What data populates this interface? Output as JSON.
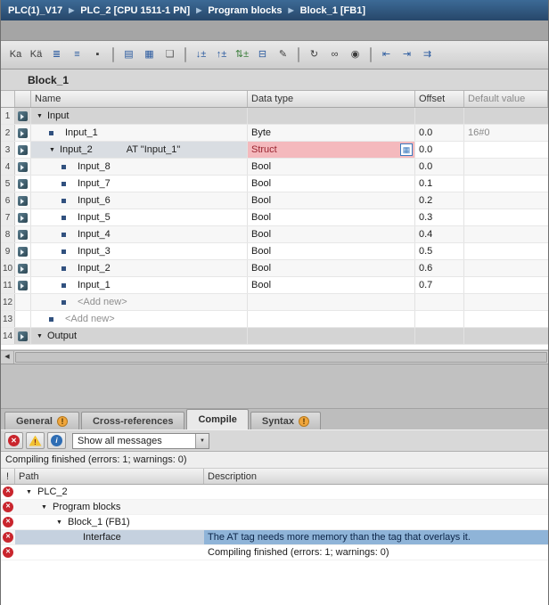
{
  "breadcrumb": {
    "items": [
      "PLC(1)_V17",
      "PLC_2 [CPU 1511-1 PN]",
      "Program blocks",
      "Block_1 [FB1]"
    ]
  },
  "block": {
    "title": "Block_1"
  },
  "toolbar": {
    "icons": [
      {
        "name": "keep-actual-values-icon",
        "glyph": "Ka",
        "color": "#3c3c3c"
      },
      {
        "name": "snapshot-actual-values-icon",
        "glyph": "Kä",
        "color": "#3c3c3c"
      },
      {
        "name": "insert-row-icon",
        "glyph": "≣",
        "color": "#2a5a9f"
      },
      {
        "name": "add-row-icon",
        "glyph": "≡",
        "color": "#2a5a9f"
      },
      {
        "name": "reset-start-values-icon",
        "glyph": "▪",
        "color": "#3c3c3c"
      },
      {
        "sep": true
      },
      {
        "name": "expand-view-icon",
        "glyph": "▤",
        "color": "#2a5a9f"
      },
      {
        "name": "tabular-view-icon",
        "glyph": "▦",
        "color": "#2a5a9f"
      },
      {
        "name": "comment-toggle-icon",
        "glyph": "❏",
        "color": "#5a5a5a"
      },
      {
        "sep": true
      },
      {
        "name": "download-values-icon",
        "glyph": "↓±",
        "color": "#2a5a9f"
      },
      {
        "name": "upload-values-icon",
        "glyph": "↑±",
        "color": "#2a5a9f"
      },
      {
        "name": "sync-values-icon",
        "glyph": "⇅±",
        "color": "#3a7d3a"
      },
      {
        "name": "toggle-display-icon",
        "glyph": "⊟",
        "color": "#2a5a9f"
      },
      {
        "name": "edit-constants-icon",
        "glyph": "✎",
        "color": "#3c3c3c"
      },
      {
        "sep": true
      },
      {
        "name": "refresh-icon",
        "glyph": "↻",
        "color": "#3c3c3c"
      },
      {
        "name": "monitor-icon",
        "glyph": "∞",
        "color": "#3c3c3c"
      },
      {
        "name": "snapshot-camera-icon",
        "glyph": "◉",
        "color": "#3c3c3c"
      },
      {
        "sep": true
      },
      {
        "name": "previous-error-icon",
        "glyph": "⇤",
        "color": "#2a5a9f"
      },
      {
        "name": "next-error-icon",
        "glyph": "⇥",
        "color": "#2a5a9f"
      },
      {
        "name": "go-to-definition-icon",
        "glyph": "⇉",
        "color": "#2a5a9f"
      }
    ]
  },
  "interface_table": {
    "columns": [
      "Name",
      "Data type",
      "Offset",
      "Default value"
    ],
    "rows": [
      {
        "num": "1",
        "icon": true,
        "expander": true,
        "indent": 0,
        "group": true,
        "name": "Input"
      },
      {
        "num": "2",
        "icon": true,
        "bullet": true,
        "indent": 1,
        "name": "Input_1",
        "datatype": "Byte",
        "offset": "0.0",
        "default": "16#0"
      },
      {
        "num": "3",
        "icon": true,
        "expander": true,
        "indent": 1,
        "selected": true,
        "dterror": true,
        "dtbutton": true,
        "name": "Input_2",
        "at": "AT \"Input_1\"",
        "datatype": "Struct",
        "offset": "0.0"
      },
      {
        "num": "4",
        "icon": true,
        "bullet": true,
        "indent": 2,
        "name": "Input_8",
        "datatype": "Bool",
        "offset": "0.0"
      },
      {
        "num": "5",
        "icon": true,
        "bullet": true,
        "indent": 2,
        "name": "Input_7",
        "datatype": "Bool",
        "offset": "0.1"
      },
      {
        "num": "6",
        "icon": true,
        "bullet": true,
        "indent": 2,
        "name": "Input_6",
        "datatype": "Bool",
        "offset": "0.2"
      },
      {
        "num": "7",
        "icon": true,
        "bullet": true,
        "indent": 2,
        "name": "Input_5",
        "datatype": "Bool",
        "offset": "0.3"
      },
      {
        "num": "8",
        "icon": true,
        "bullet": true,
        "indent": 2,
        "name": "Input_4",
        "datatype": "Bool",
        "offset": "0.4"
      },
      {
        "num": "9",
        "icon": true,
        "bullet": true,
        "indent": 2,
        "name": "Input_3",
        "datatype": "Bool",
        "offset": "0.5"
      },
      {
        "num": "10",
        "icon": true,
        "bullet": true,
        "indent": 2,
        "name": "Input_2",
        "datatype": "Bool",
        "offset": "0.6"
      },
      {
        "num": "11",
        "icon": true,
        "bullet": true,
        "indent": 2,
        "name": "Input_1",
        "datatype": "Bool",
        "offset": "0.7"
      },
      {
        "num": "12",
        "bullet": true,
        "indent": 2,
        "addnew": true,
        "name": "<Add new>"
      },
      {
        "num": "13",
        "bullet": true,
        "indent": 1,
        "addnew": true,
        "name": "<Add new>"
      },
      {
        "num": "14",
        "icon": true,
        "expander": true,
        "indent": 0,
        "group": true,
        "name": "Output"
      }
    ]
  },
  "inspector": {
    "tabs": [
      {
        "name": "tab-general",
        "label": "General",
        "warning": true
      },
      {
        "name": "tab-cross-references",
        "label": "Cross-references"
      },
      {
        "name": "tab-compile",
        "label": "Compile",
        "active": true
      },
      {
        "name": "tab-syntax",
        "label": "Syntax",
        "warning": true
      }
    ],
    "filter_value": "Show all messages",
    "status": "Compiling finished (errors: 1; warnings: 0)"
  },
  "messages": {
    "columns": [
      "!",
      "Path",
      "Description"
    ],
    "rows": [
      {
        "path": "PLC_2",
        "expander": true,
        "indent": 0
      },
      {
        "path": "Program blocks",
        "expander": true,
        "indent": 1
      },
      {
        "path": "Block_1 (FB1)",
        "expander": true,
        "indent": 2
      },
      {
        "path": "Interface",
        "indent": 3,
        "selected": true,
        "description": "The AT tag needs more memory than the tag that overlays it."
      },
      {
        "path": "",
        "description": "Compiling finished (errors: 1; warnings: 0)"
      }
    ]
  }
}
